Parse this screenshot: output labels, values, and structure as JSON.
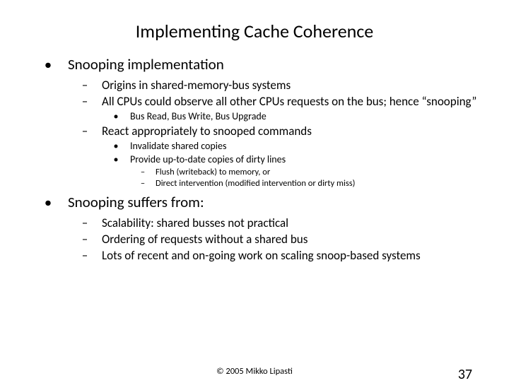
{
  "title": "Implementing Cache Coherence",
  "l1": [
    {
      "text": "Snooping implementation",
      "l2": [
        {
          "text": "Origins in shared-memory-bus systems"
        },
        {
          "text": "All CPUs could observe all other CPUs requests on the bus; hence “snooping”",
          "l3": [
            {
              "text": "Bus Read, Bus Write, Bus Upgrade"
            }
          ]
        },
        {
          "text": "React appropriately to snooped commands",
          "l3": [
            {
              "text": "Invalidate shared copies"
            },
            {
              "text": "Provide up-to-date copies of dirty lines",
              "l4": [
                {
                  "text": "Flush (writeback) to memory, or"
                },
                {
                  "text": "Direct intervention (modified intervention or dirty miss)"
                }
              ]
            }
          ]
        }
      ]
    },
    {
      "text": "Snooping suffers from:",
      "l2": [
        {
          "text": "Scalability: shared busses not practical"
        },
        {
          "text": "Ordering of requests without a shared bus"
        },
        {
          "text": "Lots of recent and on-going work on scaling snoop-based systems"
        }
      ]
    }
  ],
  "copyright": "© 2005 Mikko Lipasti",
  "pagenum": "37"
}
